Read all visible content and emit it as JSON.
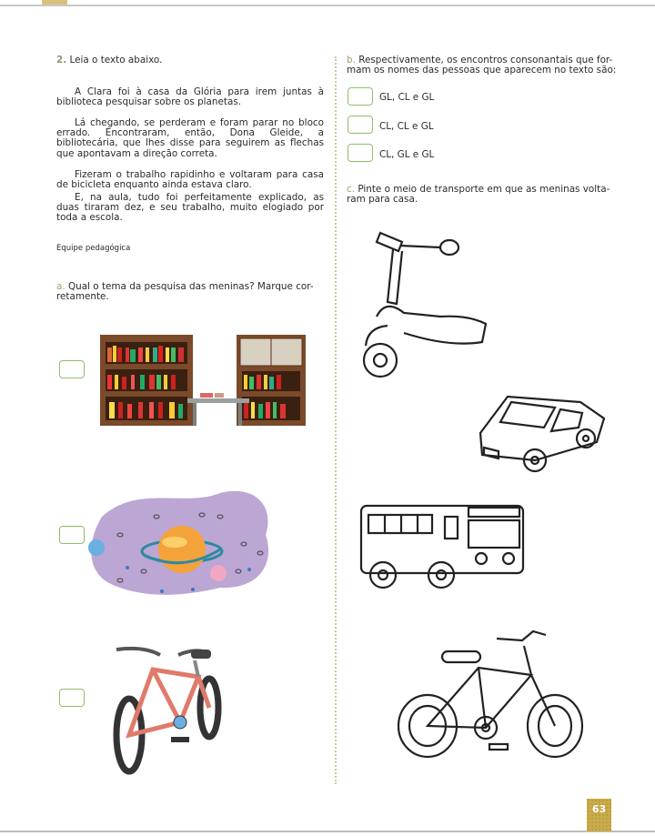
{
  "page_number": "63",
  "question2": {
    "number": "2.",
    "instruction": "Leia o texto abaixo.",
    "paragraphs": [
      "A Clara foi à casa da Glória para irem juntas à biblioteca pesquisar sobre os planetas.",
      "Lá chegando, se perderam e foram parar no bloco errado. Encontraram, então, Dona Gleide, a bibliotecária, que lhes disse para seguirem as flechas que apontavam a direção correta.",
      "Fizeram o trabalho rapidinho e voltaram para casa de bicicleta enquanto ainda estava claro.",
      "E, na aula, tudo foi perfeitamente explicado, as duas tiraram dez, e seu trabalho, muito elogiado por toda a escola."
    ],
    "credit": "Equipe pedagógica"
  },
  "item_a": {
    "letter": "a.",
    "text_line1": "Qual o tema da pesquisa das meninas? Marque cor-",
    "text_line2": "retamente.",
    "options": [
      "library-bookshelves-image",
      "planet-space-image",
      "bicycle-image"
    ]
  },
  "item_b": {
    "letter": "b.",
    "text_line1": "Respectivamente, os encontros consonantais que for-",
    "text_line2": "mam os nomes das pessoas que aparecem no texto são:",
    "options": [
      "GL, CL e GL",
      "CL, CL e GL",
      "CL, GL e GL"
    ]
  },
  "item_c": {
    "letter": "c.",
    "text_line1": "Pinte o meio de transporte em que as meninas volta-",
    "text_line2": "ram para casa.",
    "images": [
      "scooter-outline",
      "car-outline",
      "bus-outline",
      "bicycle-outline"
    ]
  },
  "colors": {
    "checkbox_border": "#8bbf6a",
    "page_number_bg": "#c9ac4a",
    "divider": "#cfc79f"
  }
}
